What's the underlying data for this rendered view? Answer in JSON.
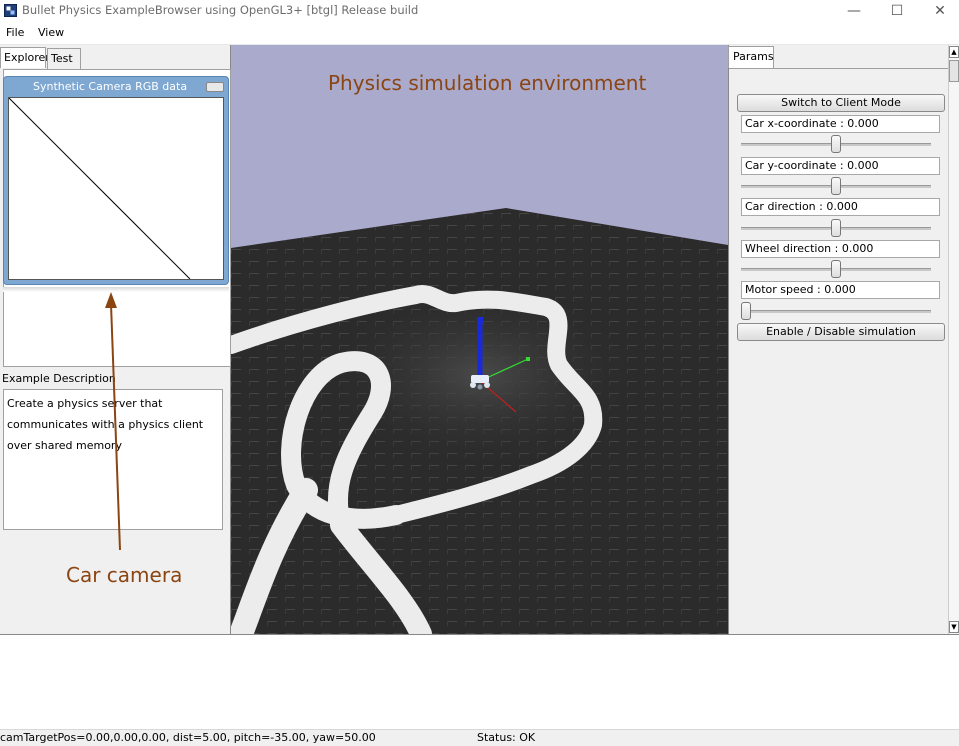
{
  "window": {
    "title": "Bullet Physics ExampleBrowser using OpenGL3+ [btgl] Release build",
    "minimize_glyph": "—",
    "maximize_glyph": "☐",
    "close_glyph": "✕"
  },
  "menu": {
    "items": [
      "File",
      "View"
    ]
  },
  "left_tabs": [
    "Explorer",
    "Test"
  ],
  "camera_window": {
    "title": "Synthetic Camera RGB data"
  },
  "example_description": {
    "label": "Example Description",
    "lines": [
      "Create a physics server that",
      "communicates with a physics client",
      "over shared memory"
    ]
  },
  "params": {
    "tab_label": "Params",
    "client_mode_button": "Switch to Client Mode",
    "sliders": [
      {
        "label": "Car x-coordinate : 0.000",
        "value": 0.5
      },
      {
        "label": "Car y-coordinate : 0.000",
        "value": 0.5
      },
      {
        "label": "Car direction : 0.000",
        "value": 0.5
      },
      {
        "label": "Wheel direction : 0.000",
        "value": 0.5
      },
      {
        "label": "Motor speed : 0.000",
        "value": 0.0
      }
    ],
    "simulation_button": "Enable / Disable simulation"
  },
  "status": {
    "camera": "camTargetPos=0.00,0.00,0.00, dist=5.00, pitch=-35.00, yaw=50.00",
    "state": "Status: OK"
  },
  "annotations": {
    "physics": "Physics simulation environment",
    "car_camera": "Car camera",
    "color": "#8b4513"
  },
  "colors": {
    "sky": "#aaaacc",
    "ground": "#2b2b2b",
    "track": "#ececec",
    "camera_frame": "#7ea7d1"
  },
  "icons": {
    "app": "bullet-app-icon"
  }
}
